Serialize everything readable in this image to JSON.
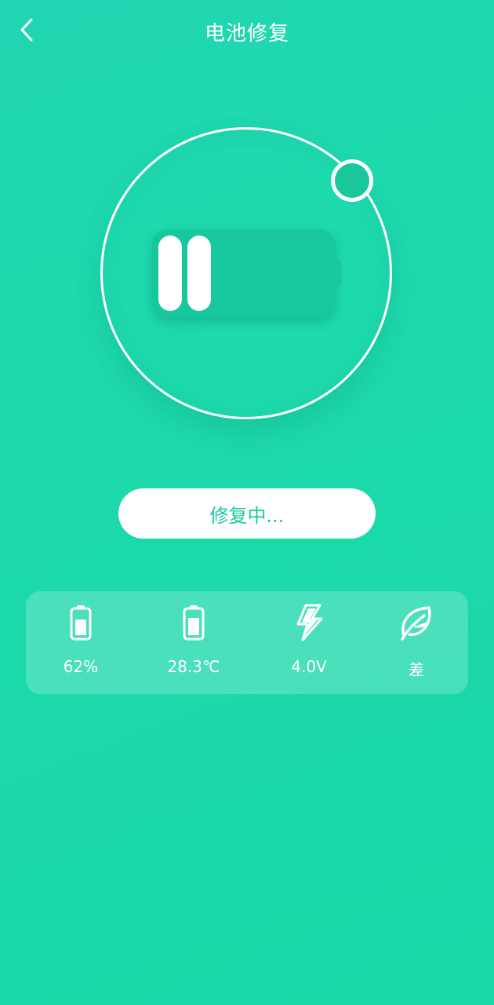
{
  "header": {
    "title": "电池修复",
    "back_icon": "chevron-left-icon"
  },
  "repair": {
    "status_label": "修复中...",
    "battery_icon": "battery-paused-icon"
  },
  "stats": {
    "items": [
      {
        "icon": "battery-level-icon",
        "value": "62%"
      },
      {
        "icon": "battery-temperature-icon",
        "value": "28.3℃"
      },
      {
        "icon": "lightning-bolt-icon",
        "value": "4.0V"
      },
      {
        "icon": "leaf-icon",
        "value": "差"
      }
    ]
  },
  "colors": {
    "background": "#1dd9ac",
    "battery_fill": "#17c79d",
    "accent_text": "#19c9a0",
    "white": "#ffffff"
  }
}
